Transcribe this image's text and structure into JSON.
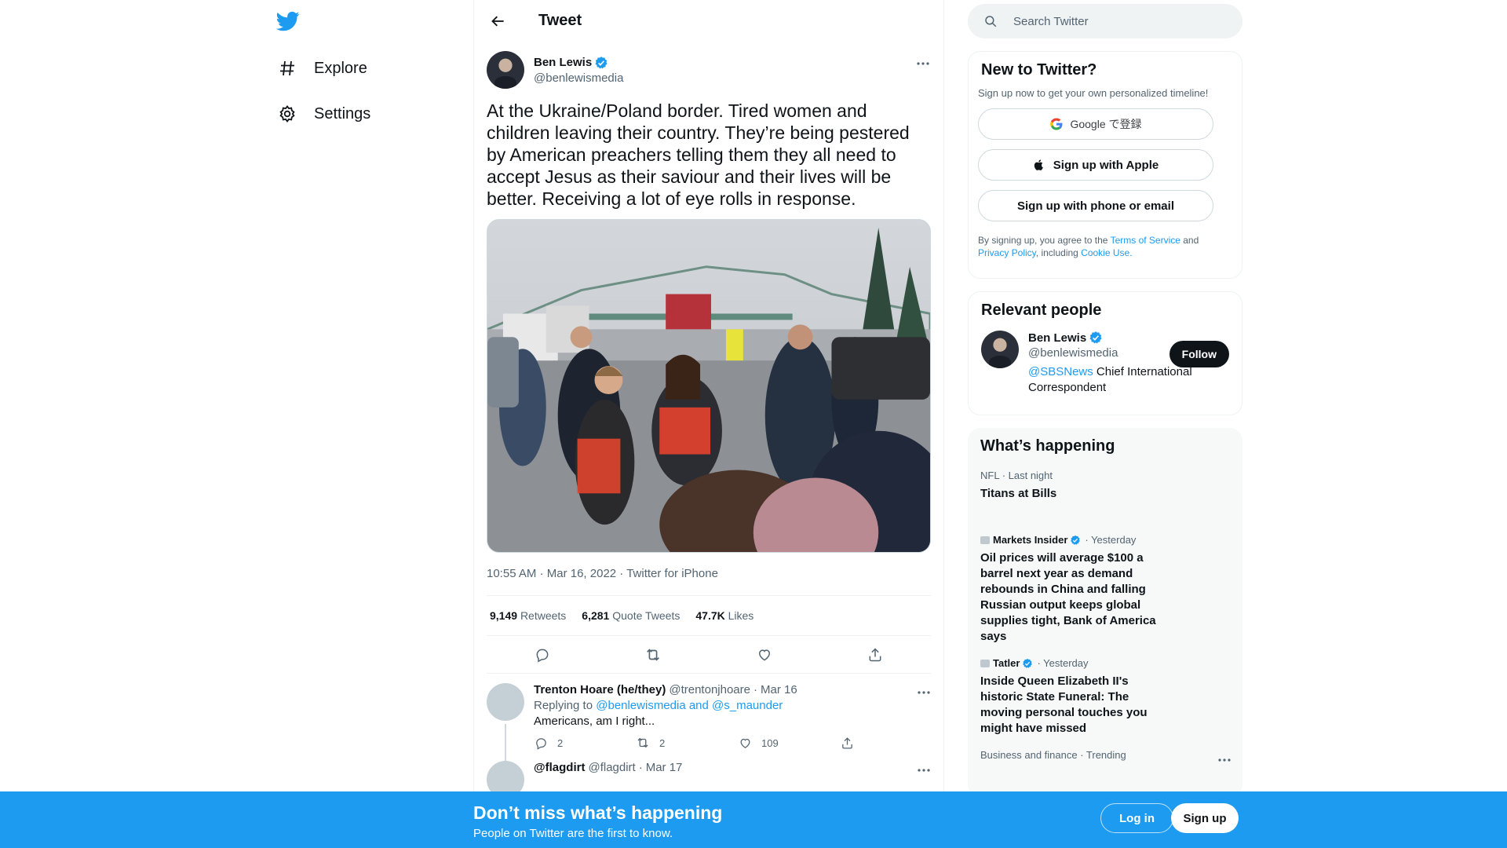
{
  "nav": {
    "logo": "twitter-bird-icon",
    "items": [
      {
        "label": "Explore",
        "icon": "hashtag-icon"
      },
      {
        "label": "Settings",
        "icon": "gear-icon"
      }
    ]
  },
  "main": {
    "header_title": "Tweet",
    "tweet": {
      "author_name": "Ben Lewis",
      "author_handle": "@benlewismedia",
      "text": "At the Ukraine/Poland border. Tired women and children leaving their country. They’re being pestered by American preachers telling them they all need to accept Jesus as their saviour and their lives will be better. Receiving a lot of eye rolls in response.",
      "time": "10:55 AM",
      "date": "Mar 16, 2022",
      "client": "Twitter for iPhone",
      "stats": {
        "retweets_count": "9,149",
        "retweets_label": "Retweets",
        "quotes_count": "6,281",
        "quotes_label": "Quote Tweets",
        "likes_count": "47.7K",
        "likes_label": "Likes"
      }
    },
    "replies": [
      {
        "name": "Trenton Hoare (he/they)",
        "handle": "@trentonjhoare",
        "date": "Mar 16",
        "replying_prefix": "Replying to",
        "replying_to": "@benlewismedia and @s_maunder",
        "text": "Americans, am I right...",
        "reply_count": "2",
        "retweet_count": "2",
        "like_count": "109"
      },
      {
        "name": "@flagdirt",
        "handle": "@flagdirt",
        "date": "Mar 17"
      }
    ]
  },
  "right": {
    "search_placeholder": "Search Twitter",
    "new_to_twitter": {
      "title": "New to Twitter?",
      "subtitle": "Sign up now to get your own personalized timeline!",
      "google_label": "Google で登録",
      "apple_label": "Sign up with Apple",
      "phone_label": "Sign up with phone or email",
      "terms_prefix": "By signing up, you agree to the ",
      "terms_link": "Terms of Service",
      "terms_and": " and",
      "privacy_link": "Privacy Policy",
      "including": ", including ",
      "cookie_link": "Cookie Use."
    },
    "relevant": {
      "title": "Relevant people",
      "name": "Ben Lewis",
      "handle": "@benlewismedia",
      "bio_link": "@SBSNews",
      "bio_rest": " Chief International Correspondent",
      "follow_label": "Follow"
    },
    "happening": {
      "title": "What’s happening",
      "trends": [
        {
          "context": "NFL · Last night",
          "headline": "Titans at Bills"
        },
        {
          "source": "Markets Insider",
          "time": "· Yesterday",
          "headline": "Oil prices will average $100 a barrel next year as demand rebounds in China and falling Russian output keeps global supplies tight, Bank of America says"
        },
        {
          "source": "Tatler",
          "time": "· Yesterday",
          "headline": "Inside Queen Elizabeth II's historic State Funeral: The moving personal touches you might have missed"
        },
        {
          "context": "Business and finance · Trending"
        }
      ]
    }
  },
  "banner": {
    "title": "Don’t miss what’s happening",
    "subtitle": "People on Twitter are the first to know.",
    "login_label": "Log in",
    "signup_label": "Sign up"
  },
  "colors": {
    "accent": "#1d9bf0",
    "text": "#0f1419",
    "secondary": "#536471"
  }
}
